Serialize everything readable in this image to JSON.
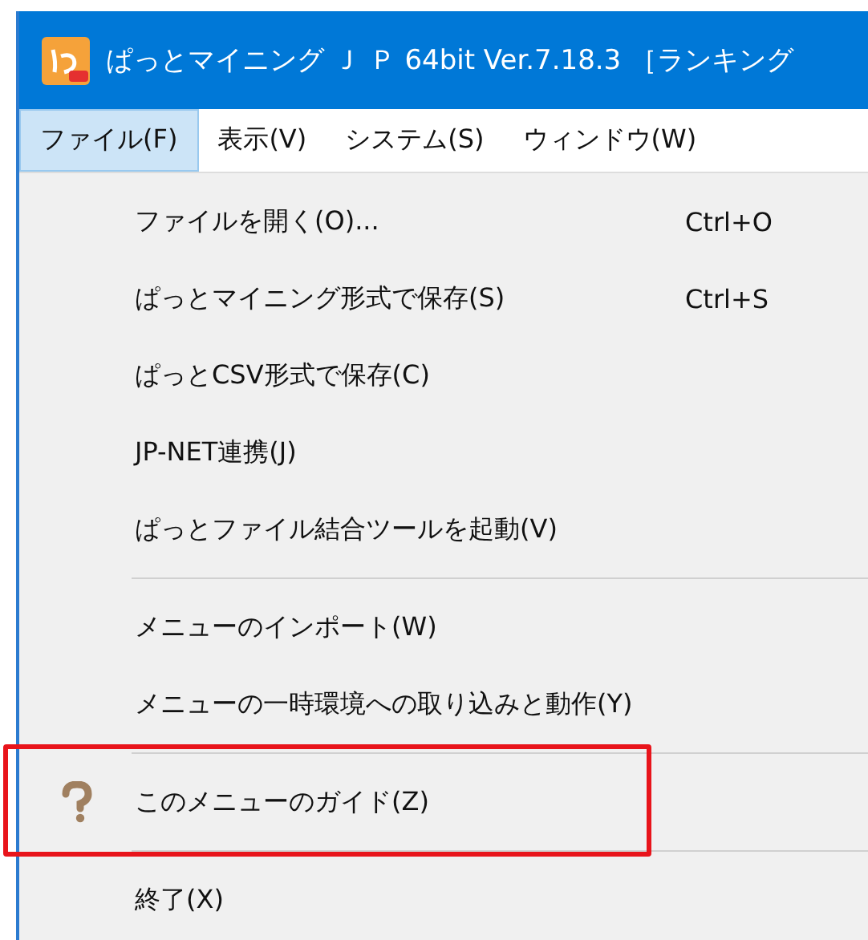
{
  "window": {
    "title": "ぱっとマイニング Ｊ Ｐ 64bit Ver.7.18.3 ［ランキング"
  },
  "menubar": [
    {
      "label": "ファイル(F)",
      "selected": true
    },
    {
      "label": "表示(V)",
      "selected": false
    },
    {
      "label": "システム(S)",
      "selected": false
    },
    {
      "label": "ウィンドウ(W)",
      "selected": false
    }
  ],
  "menu": [
    {
      "kind": "item",
      "label": "ファイルを開く(O)...",
      "shortcut": "Ctrl+O",
      "highlighted": false
    },
    {
      "kind": "item",
      "label": "ぱっとマイニング形式で保存(S)",
      "shortcut": "Ctrl+S",
      "highlighted": false
    },
    {
      "kind": "item",
      "label": "ぱっとCSV形式で保存(C)",
      "highlighted": false
    },
    {
      "kind": "item",
      "label": "JP-NET連携(J)",
      "highlighted": false
    },
    {
      "kind": "item",
      "label": "ぱっとファイル結合ツールを起動(V)",
      "highlighted": false
    },
    {
      "kind": "separator"
    },
    {
      "kind": "item",
      "label": "メニューのインポート(W)",
      "highlighted": false
    },
    {
      "kind": "item",
      "label": "メニューの一時環境への取り込みと動作(Y)",
      "highlighted": false
    },
    {
      "kind": "separator"
    },
    {
      "kind": "help",
      "label": "このメニューのガイド(Z)",
      "highlighted": true
    },
    {
      "kind": "separator"
    },
    {
      "kind": "item",
      "label": "終了(X)",
      "highlighted": false
    }
  ]
}
